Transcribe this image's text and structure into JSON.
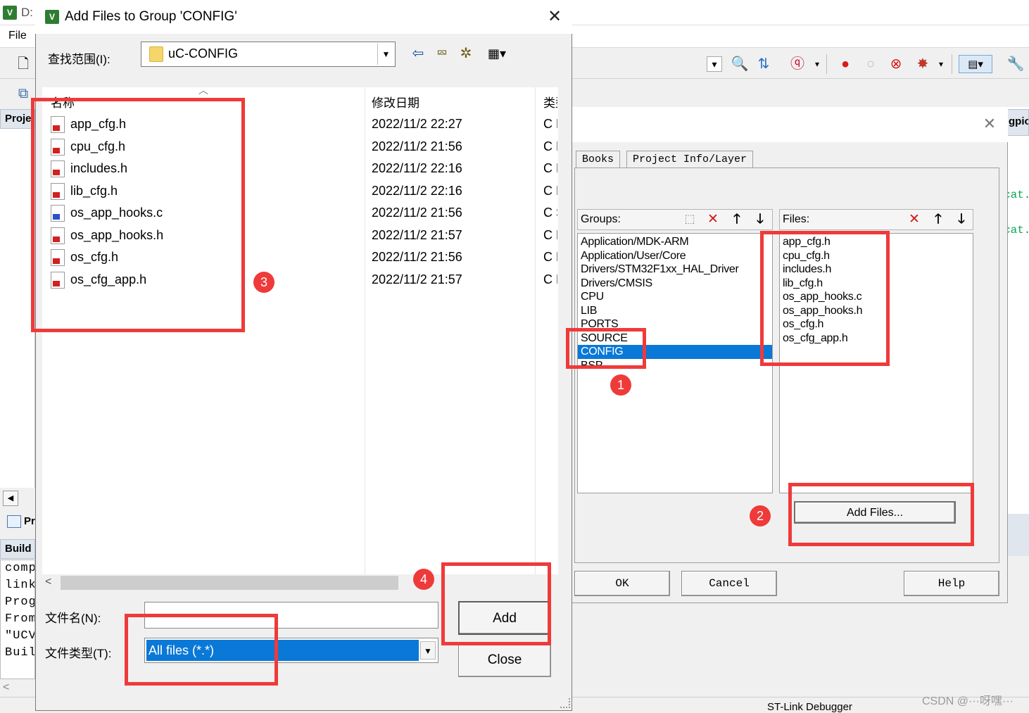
{
  "ide": {
    "title": "D:",
    "app_icon_text": "V",
    "menu_file": "File",
    "project_tab": "Proje",
    "project_tab2": "Pr",
    "build_tab": "Build",
    "build_lines": [
      "comp",
      "link",
      "Prog",
      "From",
      "\"UCV",
      "Buil"
    ],
    "right_tab": "gpio",
    "code_line_1": "cat.",
    "code_line_2": "cat.",
    "debugger_status": "ST-Link Debugger",
    "watermark": "CSDN @···呀嘿···"
  },
  "manage_dialog": {
    "tabs": [
      "Books",
      "Project Info/Layer"
    ],
    "groups_label": "Groups:",
    "files_label": "Files:",
    "groups": [
      "Application/MDK-ARM",
      "Application/User/Core",
      "Drivers/STM32F1xx_HAL_Driver",
      "Drivers/CMSIS",
      "CPU",
      "LIB",
      "PORTS",
      "SOURCE",
      "CONFIG",
      "BSP"
    ],
    "selected_group": "CONFIG",
    "files": [
      "app_cfg.h",
      "cpu_cfg.h",
      "includes.h",
      "lib_cfg.h",
      "os_app_hooks.c",
      "os_app_hooks.h",
      "os_cfg.h",
      "os_cfg_app.h"
    ],
    "add_files_button": "Add Files...",
    "ok_button": "OK",
    "cancel_button": "Cancel",
    "help_button": "Help"
  },
  "add_files_dialog": {
    "title": "Add Files to Group 'CONFIG'",
    "icon_text": "V",
    "look_in_label": "查找范围(I):",
    "look_in_value": "uC-CONFIG",
    "col_name": "名称",
    "col_date": "修改日期",
    "col_type": "类型",
    "files": [
      {
        "name": "app_cfg.h",
        "date": "2022/11/2 22:27",
        "type": "C H",
        "kind": "h"
      },
      {
        "name": "cpu_cfg.h",
        "date": "2022/11/2 21:56",
        "type": "C H",
        "kind": "h"
      },
      {
        "name": "includes.h",
        "date": "2022/11/2 22:16",
        "type": "C H",
        "kind": "h"
      },
      {
        "name": "lib_cfg.h",
        "date": "2022/11/2 22:16",
        "type": "C H",
        "kind": "h"
      },
      {
        "name": "os_app_hooks.c",
        "date": "2022/11/2 21:56",
        "type": "C S",
        "kind": "c"
      },
      {
        "name": "os_app_hooks.h",
        "date": "2022/11/2 21:57",
        "type": "C H",
        "kind": "h"
      },
      {
        "name": "os_cfg.h",
        "date": "2022/11/2 21:56",
        "type": "C H",
        "kind": "h"
      },
      {
        "name": "os_cfg_app.h",
        "date": "2022/11/2 21:57",
        "type": "C H",
        "kind": "h"
      }
    ],
    "file_name_label": "文件名(N):",
    "file_name_value": "",
    "file_type_label": "文件类型(T):",
    "file_type_value": "All files (*.*)",
    "add_button": "Add",
    "close_button": "Close"
  },
  "annotations": {
    "numbers": [
      "1",
      "2",
      "3",
      "4"
    ],
    "color": "#ef3a3a"
  },
  "colors": {
    "selection": "#0a78d7",
    "annotation": "#ef3a3a"
  }
}
